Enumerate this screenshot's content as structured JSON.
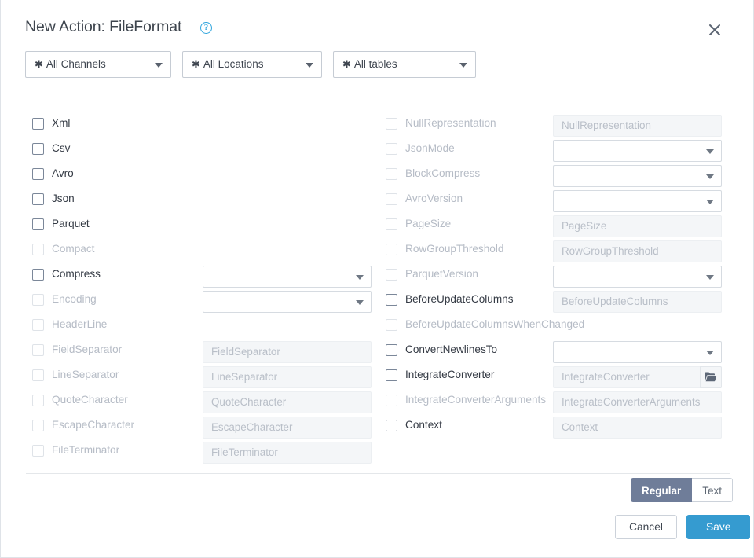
{
  "header": {
    "title": "New Action: FileFormat",
    "help_icon": "help-circle-icon",
    "close_icon": "close-icon"
  },
  "filters": [
    {
      "label": "All Channels",
      "prefix": "✱",
      "icon": "chevron-down-icon"
    },
    {
      "label": "All Locations",
      "prefix": "✱",
      "icon": "chevron-down-icon"
    },
    {
      "label": "All tables",
      "prefix": "✱",
      "icon": "chevron-down-icon"
    }
  ],
  "left_column": [
    {
      "label": "Xml",
      "enabled": true,
      "checked": false,
      "field": "none"
    },
    {
      "label": "Csv",
      "enabled": true,
      "checked": false,
      "field": "none"
    },
    {
      "label": "Avro",
      "enabled": true,
      "checked": false,
      "field": "none"
    },
    {
      "label": "Json",
      "enabled": true,
      "checked": false,
      "field": "none"
    },
    {
      "label": "Parquet",
      "enabled": true,
      "checked": false,
      "field": "none"
    },
    {
      "label": "Compact",
      "enabled": false,
      "checked": false,
      "field": "none"
    },
    {
      "label": "Compress",
      "enabled": true,
      "checked": false,
      "field": "select",
      "value": ""
    },
    {
      "label": "Encoding",
      "enabled": false,
      "checked": false,
      "field": "select",
      "value": ""
    },
    {
      "label": "HeaderLine",
      "enabled": false,
      "checked": false,
      "field": "none"
    },
    {
      "label": "FieldSeparator",
      "enabled": false,
      "checked": false,
      "field": "text",
      "placeholder": "FieldSeparator"
    },
    {
      "label": "LineSeparator",
      "enabled": false,
      "checked": false,
      "field": "text",
      "placeholder": "LineSeparator"
    },
    {
      "label": "QuoteCharacter",
      "enabled": false,
      "checked": false,
      "field": "text",
      "placeholder": "QuoteCharacter"
    },
    {
      "label": "EscapeCharacter",
      "enabled": false,
      "checked": false,
      "field": "text",
      "placeholder": "EscapeCharacter"
    },
    {
      "label": "FileTerminator",
      "enabled": false,
      "checked": false,
      "field": "text",
      "placeholder": "FileTerminator"
    }
  ],
  "right_column": [
    {
      "label": "NullRepresentation",
      "enabled": false,
      "checked": false,
      "field": "text",
      "placeholder": "NullRepresentation"
    },
    {
      "label": "JsonMode",
      "enabled": false,
      "checked": false,
      "field": "select",
      "value": ""
    },
    {
      "label": "BlockCompress",
      "enabled": false,
      "checked": false,
      "field": "select",
      "value": ""
    },
    {
      "label": "AvroVersion",
      "enabled": false,
      "checked": false,
      "field": "select",
      "value": ""
    },
    {
      "label": "PageSize",
      "enabled": false,
      "checked": false,
      "field": "text",
      "placeholder": "PageSize"
    },
    {
      "label": "RowGroupThreshold",
      "enabled": false,
      "checked": false,
      "field": "text",
      "placeholder": "RowGroupThreshold"
    },
    {
      "label": "ParquetVersion",
      "enabled": false,
      "checked": false,
      "field": "select",
      "value": ""
    },
    {
      "label": "BeforeUpdateColumns",
      "enabled": true,
      "checked": false,
      "field": "text",
      "placeholder": "BeforeUpdateColumns"
    },
    {
      "label": "BeforeUpdateColumnsWhenChanged",
      "enabled": false,
      "checked": false,
      "field": "none"
    },
    {
      "label": "ConvertNewlinesTo",
      "enabled": true,
      "checked": false,
      "field": "select",
      "value": ""
    },
    {
      "label": "IntegrateConverter",
      "enabled": true,
      "checked": false,
      "field": "text",
      "placeholder": "IntegrateConverter",
      "button": "folder-open-icon"
    },
    {
      "label": "IntegrateConverterArguments",
      "enabled": false,
      "checked": false,
      "field": "text",
      "placeholder": "IntegrateConverterArguments"
    },
    {
      "label": "Context",
      "enabled": true,
      "checked": false,
      "field": "text",
      "placeholder": "Context"
    }
  ],
  "footer": {
    "view_toggle": [
      {
        "label": "Regular",
        "active": true
      },
      {
        "label": "Text",
        "active": false
      }
    ],
    "cancel_label": "Cancel",
    "save_label": "Save"
  },
  "colors": {
    "accent_blue": "#359bd0",
    "help_blue": "#2fa5dd",
    "toggle_active": "#6f7d99",
    "label_enabled": "#353b45",
    "label_disabled": "#b6bcc6"
  }
}
